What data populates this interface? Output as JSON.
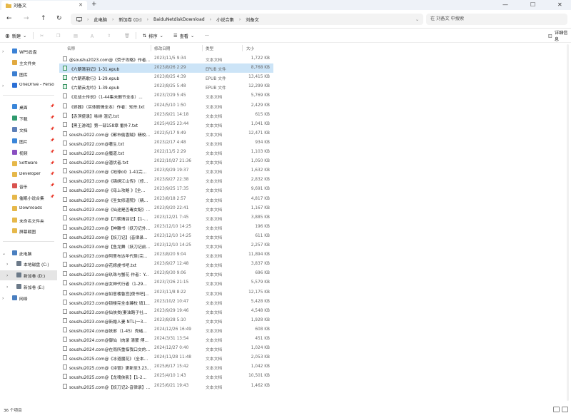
{
  "window": {
    "tab_title": "刘备文",
    "min_glyph": "—",
    "max_glyph": "☐",
    "close_glyph": "✕"
  },
  "address": {
    "crumbs": [
      "此电脑",
      "新加卷 (D:)",
      "BaiduNetdiskDownload",
      "小说合集",
      "刘备文"
    ],
    "search_placeholder": "在 刘备文 中搜索"
  },
  "toolbar": {
    "new_label": "新建",
    "sort_label": "排序",
    "view_label": "查看",
    "more_label": "···",
    "details_label": "详细信息"
  },
  "sidebar": {
    "items": [
      {
        "label": "WPS云盘",
        "icon": "cloud-icon",
        "color": "#3b82d6"
      },
      {
        "label": "主文件夹",
        "icon": "home-icon",
        "color": "#e1a93f"
      },
      {
        "label": "图库",
        "icon": "gallery-icon",
        "color": "#3c7fd1"
      },
      {
        "label": "OneDrive - Perso",
        "icon": "onedrive-icon",
        "color": "#2b6fd6"
      },
      {
        "label": "桌面",
        "icon": "desktop-icon",
        "color": "#3a86d9"
      },
      {
        "label": "下载",
        "icon": "download-icon",
        "color": "#2f9a6e"
      },
      {
        "label": "文档",
        "icon": "document-icon",
        "color": "#5d7fb8"
      },
      {
        "label": "图片",
        "icon": "pictures-icon",
        "color": "#3a86d9"
      },
      {
        "label": "视频",
        "icon": "video-icon",
        "color": "#8a4fc1"
      },
      {
        "label": "Software",
        "icon": "folder-icon",
        "color": "#e6b84a"
      },
      {
        "label": "Developer",
        "icon": "folder-icon",
        "color": "#e6b84a"
      },
      {
        "label": "音乐",
        "icon": "music-icon",
        "color": "#d9534f"
      },
      {
        "label": "催眠小说合集",
        "icon": "folder-icon",
        "color": "#e6b84a"
      },
      {
        "label": "Downloads",
        "icon": "folder-icon",
        "color": "#e6b84a"
      },
      {
        "label": "未命名文件夹",
        "icon": "folder-icon",
        "color": "#e6b84a"
      },
      {
        "label": "屏幕截图",
        "icon": "folder-icon",
        "color": "#e6b84a"
      },
      {
        "label": "此电脑",
        "icon": "computer-icon",
        "color": "#4a7fc0"
      },
      {
        "label": "本地磁盘 (C:)",
        "icon": "drive-icon",
        "color": "#6c7a89"
      },
      {
        "label": "新加卷 (D:)",
        "icon": "drive-icon",
        "color": "#6c7a89"
      },
      {
        "label": "新加卷 (E:)",
        "icon": "drive-icon",
        "color": "#6c7a89"
      },
      {
        "label": "网络",
        "icon": "network-icon",
        "color": "#4a7fc0"
      }
    ]
  },
  "columns": {
    "name": "名称",
    "date": "修改日期",
    "type": "类型",
    "size": "大小"
  },
  "files": [
    {
      "name": "@soushu2023.com@《荧子攻略》作者...",
      "date": "2023/11/5 9:34",
      "type": "文本文档",
      "size": "1,722 KB",
      "icon": "text-file-icon"
    },
    {
      "name": "《六朝清羽记》1-31.epub",
      "date": "2023/8/26 2:29",
      "type": "EPUB 文件",
      "size": "8,768 KB",
      "icon": "epub-file-icon"
    },
    {
      "name": "《六朝燕歌行》1-29.epub",
      "date": "2023/8/25 4:39",
      "type": "EPUB 文件",
      "size": "13,415 KB",
      "icon": "epub-file-icon"
    },
    {
      "name": "《六朝云龙吟》1-39.epub",
      "date": "2023/8/25 5:48",
      "type": "EPUB 文件",
      "size": "12,299 KB",
      "icon": "epub-file-icon"
    },
    {
      "name": "《龙战士传说》（1-44集未删节全本）...",
      "date": "2023/7/29 5:45",
      "type": "文本文档",
      "size": "5,769 KB",
      "icon": "text-file-icon"
    },
    {
      "name": "《邪器》（实体剧情全本）作者：知乐.txt",
      "date": "2024/5/10 1:50",
      "type": "文本文档",
      "size": "2,429 KB",
      "icon": "text-file-icon"
    },
    {
      "name": "【赤溟使录】咏绯 混记.txt",
      "date": "2023/9/21 14:18",
      "type": "文本文档",
      "size": "615 KB",
      "icon": "text-file-icon"
    },
    {
      "name": "【黑王游戏】第一部158章 番外7.txt",
      "date": "2025/4/25 23:44",
      "type": "文本文档",
      "size": "1,041 KB",
      "icon": "text-file-icon"
    },
    {
      "name": "soushu2022.com@《都市偷香贼》精校...",
      "date": "2022/5/17 9:49",
      "type": "文本文档",
      "size": "12,471 KB",
      "icon": "text-file-icon"
    },
    {
      "name": "soushu2022.com@著生.txt",
      "date": "2023/2/17 4:48",
      "type": "文本文档",
      "size": "934 KB",
      "icon": "text-file-icon"
    },
    {
      "name": "soushu2022.com@魔道.txt",
      "date": "2022/11/5 2:29",
      "type": "文本文档",
      "size": "1,103 KB",
      "icon": "text-file-icon"
    },
    {
      "name": "soushu2022.com@潜伏者.txt",
      "date": "2022/10/27 21:36",
      "type": "文本文档",
      "size": "1,050 KB",
      "icon": "text-file-icon"
    },
    {
      "name": "soushu2023.com@《地球ol》1-41完...",
      "date": "2023/9/29 19:37",
      "type": "文本文档",
      "size": "1,632 KB",
      "icon": "text-file-icon"
    },
    {
      "name": "soushu2023.com@《锦绣江山传》（修...",
      "date": "2023/9/27 22:38",
      "type": "文本文档",
      "size": "2,832 KB",
      "icon": "text-file-icon"
    },
    {
      "name": "soushu2023.com@《母上攻略 》【全...",
      "date": "2023/9/25 17:35",
      "type": "文本文档",
      "size": "9,691 KB",
      "icon": "text-file-icon"
    },
    {
      "name": "soushu2023.com@《圣女修道院》（精...",
      "date": "2023/8/18 2:57",
      "type": "文本文档",
      "size": "4,817 KB",
      "icon": "text-file-icon"
    },
    {
      "name": "soushu2023.com@《仙途是否毒女配》...",
      "date": "2023/9/20 22:41",
      "type": "文本文档",
      "size": "1,167 KB",
      "icon": "text-file-icon"
    },
    {
      "name": "soushu2023.com@【六朝清羽记】【1-...",
      "date": "2023/12/21 7:45",
      "type": "文本文档",
      "size": "3,885 KB",
      "icon": "text-file-icon"
    },
    {
      "name": "soushu2023.com@【神雕书（妖刀记外...",
      "date": "2023/12/10 14:25",
      "type": "文本文档",
      "size": "196 KB",
      "icon": "text-file-icon"
    },
    {
      "name": "soushu2023.com@【妖刀记】(音律录...",
      "date": "2023/12/10 14:25",
      "type": "文本文档",
      "size": "611 KB",
      "icon": "text-file-icon"
    },
    {
      "name": "soushu2023.com@【鱼龙舞（妖刀记前...",
      "date": "2023/12/10 14:25",
      "type": "文本文档",
      "size": "2,257 KB",
      "icon": "text-file-icon"
    },
    {
      "name": "soushu2023.com@阿里布达年代祭(完...",
      "date": "2023/8/20 9:04",
      "type": "文本文档",
      "size": "11,894 KB",
      "icon": "text-file-icon"
    },
    {
      "name": "soushu2023.com@花嫁虔书吧.txt",
      "date": "2023/9/27 12:48",
      "type": "文本文档",
      "size": "3,837 KB",
      "icon": "text-file-icon"
    },
    {
      "name": "soushu2023.com@玖珠与蟹花 作者：Y...",
      "date": "2023/9/30 9:06",
      "type": "文本文档",
      "size": "696 KB",
      "icon": "text-file-icon"
    },
    {
      "name": "soushu2023.com@女神代行者（1-29...",
      "date": "2023/7/26 21:15",
      "type": "文本文档",
      "size": "5,579 KB",
      "icon": "text-file-icon"
    },
    {
      "name": "soushu2023.com@如意楼鲁宫[傻书吧]...",
      "date": "2023/11/8 8:22",
      "type": "文本文档",
      "size": "12,175 KB",
      "icon": "text-file-icon"
    },
    {
      "name": "soushu2023.com@锁楼完全本臻校 填1...",
      "date": "2023/10/2 10:47",
      "type": "文本文档",
      "size": "5,428 KB",
      "icon": "text-file-icon"
    },
    {
      "name": "soushu2023.com@仙侠类(妻油路子社...",
      "date": "2023/9/29 19:46",
      "type": "文本文档",
      "size": "4,548 KB",
      "icon": "text-file-icon"
    },
    {
      "name": "soushu2023.com@新婚人妻 NTL(一3...",
      "date": "2023/8/28 5:10",
      "type": "文本文档",
      "size": "1,928 KB",
      "icon": "text-file-icon"
    },
    {
      "name": "soushu2024.com@妖邪（1-45）壳绪...",
      "date": "2024/12/26 16:49",
      "type": "文本文档",
      "size": "608 KB",
      "icon": "text-file-icon"
    },
    {
      "name": "soushu2024.com@御仙（肉录 清蒙 傅...",
      "date": "2024/3/31 13:54",
      "type": "文本文档",
      "size": "451 KB",
      "icon": "text-file-icon"
    },
    {
      "name": "soushu2024.com@在雨所重临我口交的...",
      "date": "2024/12/27 0:40",
      "type": "文本文档",
      "size": "1,024 KB",
      "icon": "text-file-icon"
    },
    {
      "name": "soushu2025.com@《冰道魔花》（全本...",
      "date": "2024/11/28 11:48",
      "type": "文本文档",
      "size": "2,053 KB",
      "icon": "text-file-icon"
    },
    {
      "name": "soushu2025.com@《诗冒》更新至3.23...",
      "date": "2025/6/17 15:42",
      "type": "文本文档",
      "size": "1,042 KB",
      "icon": "text-file-icon"
    },
    {
      "name": "soushu2025.com@【龙魂侠影】【1-2...",
      "date": "2025/4/10 1:43",
      "type": "文本文档",
      "size": "10,501 KB",
      "icon": "text-file-icon"
    },
    {
      "name": "soushu2025.com@【妖刀记2-音律录】...",
      "date": "2025/6/21 19:43",
      "type": "文本文档",
      "size": "1,462 KB",
      "icon": "text-file-icon"
    }
  ],
  "status": {
    "count": "36 个项目"
  }
}
